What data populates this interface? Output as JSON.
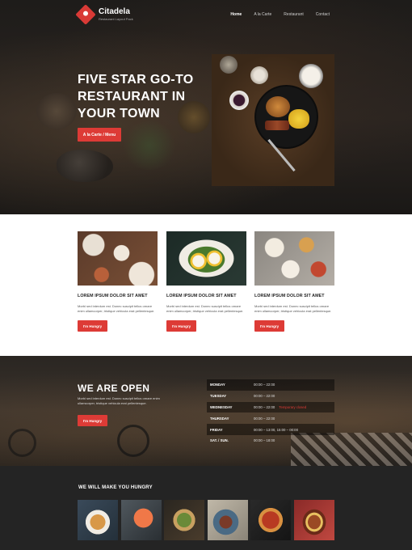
{
  "brand": {
    "name": "Citadela",
    "tagline": "Restaurant Layout Pack"
  },
  "nav": {
    "items": [
      "Home",
      "A la Carte",
      "Restaurant",
      "Contact"
    ],
    "active": "Home"
  },
  "hero": {
    "title": "FIVE STAR GO-TO RESTAURANT IN YOUR TOWN",
    "button": "A la Carte / Menu"
  },
  "cards": [
    {
      "title": "LOREM IPSUM DOLOR SIT AMET",
      "text": "Morbi sed interdum est. Donec suscipit tellus ornare enim ullamcorper, tristique vehicula erat pellentesque.",
      "button": "I'm Hungry"
    },
    {
      "title": "LOREM IPSUM DOLOR SIT AMET",
      "text": "Morbi sed interdum est. Donec suscipit tellus ornare enim ullamcorper, tristique vehicula erat pellentesque.",
      "button": "I'm Hungry"
    },
    {
      "title": "LOREM IPSUM DOLOR SIT AMET",
      "text": "Morbi sed interdum est. Donec suscipit tellus ornare enim ullamcorper, tristique vehicula erat pellentesque.",
      "button": "I'm Hungry"
    }
  ],
  "open": {
    "title": "WE ARE OPEN",
    "text": "Morbi sed interdum est. Donec suscipit tellus ornare enim ullamcorper, tristique vehicula erat pellentesque.",
    "button": "I'm Hungry",
    "hours": [
      {
        "day": "MONDAY",
        "time": "00:00 – 22:00",
        "note": ""
      },
      {
        "day": "TUESDAY",
        "time": "00:00 – 22:00",
        "note": ""
      },
      {
        "day": "WEDNESDAY",
        "time": "00:00 – 22:00",
        "note": "Temporary closed"
      },
      {
        "day": "THURSDAY",
        "time": "00:00 – 22:00",
        "note": ""
      },
      {
        "day": "FRIDAY",
        "time": "00:00 – 13:00, 15:00 – 00:00",
        "note": ""
      },
      {
        "day": "SAT. / SUN.",
        "time": "00:00 – 18:00",
        "note": ""
      }
    ]
  },
  "gallery": {
    "title": "WE WILL MAKE YOU HUNGRY"
  },
  "colors": {
    "accent": "#dd3b36",
    "dark": "#242424"
  }
}
